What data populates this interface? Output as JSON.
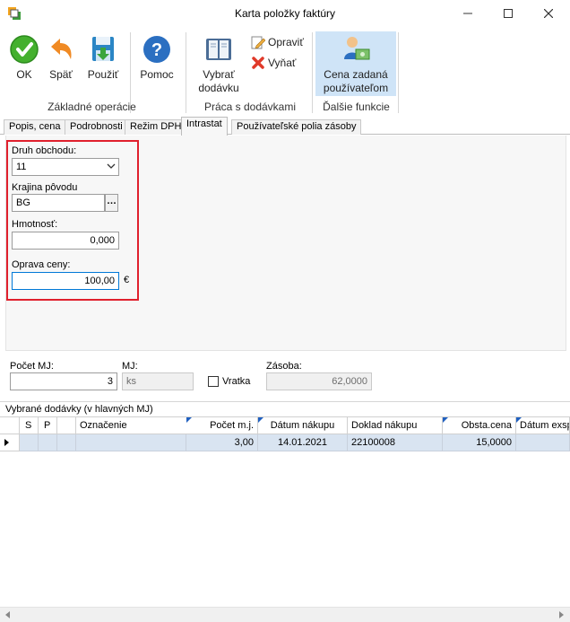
{
  "window": {
    "title": "Karta položky faktúry"
  },
  "ribbon": {
    "ok_label": "OK",
    "back_label": "Späť",
    "apply_label": "Použiť",
    "help_label": "Pomoc",
    "group_basic": "Základné operácie",
    "select_supply_label_1": "Vybrať",
    "select_supply_label_2": "dodávku",
    "edit_label": "Opraviť",
    "remove_label": "Vyňať",
    "group_supplies": "Práca s dodávkami",
    "user_price_label_1": "Cena zadaná",
    "user_price_label_2": "používateľom",
    "group_more": "Ďalšie funkcie"
  },
  "tabs": [
    {
      "label": "Popis, cena"
    },
    {
      "label": "Podrobnosti"
    },
    {
      "label": "Režim DPH"
    },
    {
      "label": "Intrastat"
    },
    {
      "label": "Používateľské polia zásoby"
    }
  ],
  "intrastat": {
    "trade_type_label": "Druh obchodu:",
    "trade_type_value": "11",
    "country_label": "Krajina pôvodu",
    "country_value": "BG",
    "weight_label": "Hmotnosť:",
    "weight_value": "0,000",
    "price_correction_label": "Oprava ceny:",
    "price_correction_value": "100,00",
    "currency": "€"
  },
  "lower": {
    "qty_label": "Počet MJ:",
    "qty_value": "3",
    "unit_label": "MJ:",
    "unit_value": "ks",
    "return_label": "Vratka",
    "stock_label": "Zásoba:",
    "stock_value": "62,0000"
  },
  "grid": {
    "caption": "Vybrané dodávky (v hlavných MJ)",
    "columns": [
      "S",
      "P",
      "Označenie",
      "Počet m.j.",
      "Dátum nákupu",
      "Doklad nákupu",
      "Obsta.cena",
      "Dátum exsp"
    ],
    "rows": [
      {
        "s": "",
        "p": "",
        "label": "",
        "qty": "3,00",
        "date": "14.01.2021",
        "doc": "22100008",
        "price": "15,0000",
        "exp": ""
      }
    ]
  }
}
